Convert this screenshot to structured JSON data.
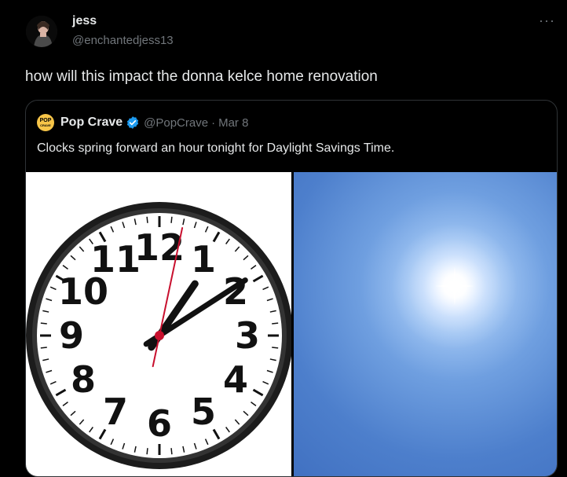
{
  "tweet": {
    "author_name": "jess",
    "author_handle": "@enchantedjess13",
    "more_label": "···",
    "text": "how will this impact the donna kelce home renovation"
  },
  "quoted_tweet": {
    "logo_text_top": "POP",
    "logo_text_bottom": "CRAVE",
    "author_name": "Pop Crave",
    "author_handle": "@PopCrave",
    "separator": "·",
    "date": "Mar 8",
    "text": "Clocks spring forward an hour tonight for Daylight Savings Time."
  },
  "clock": {
    "numerals": [
      "12",
      "1",
      "2",
      "3",
      "4",
      "5",
      "6",
      "7",
      "8",
      "9",
      "10",
      "11"
    ],
    "time": {
      "hour": 1,
      "minute": 9,
      "second": 32
    }
  },
  "colors": {
    "background": "#000000",
    "text_primary": "#e7e9ea",
    "text_secondary": "#71767b",
    "verified_blue": "#1d9bf0",
    "second_hand": "#c8102e"
  },
  "icons": {
    "verified": "verified-badge-icon",
    "more": "more-horizontal-icon"
  }
}
